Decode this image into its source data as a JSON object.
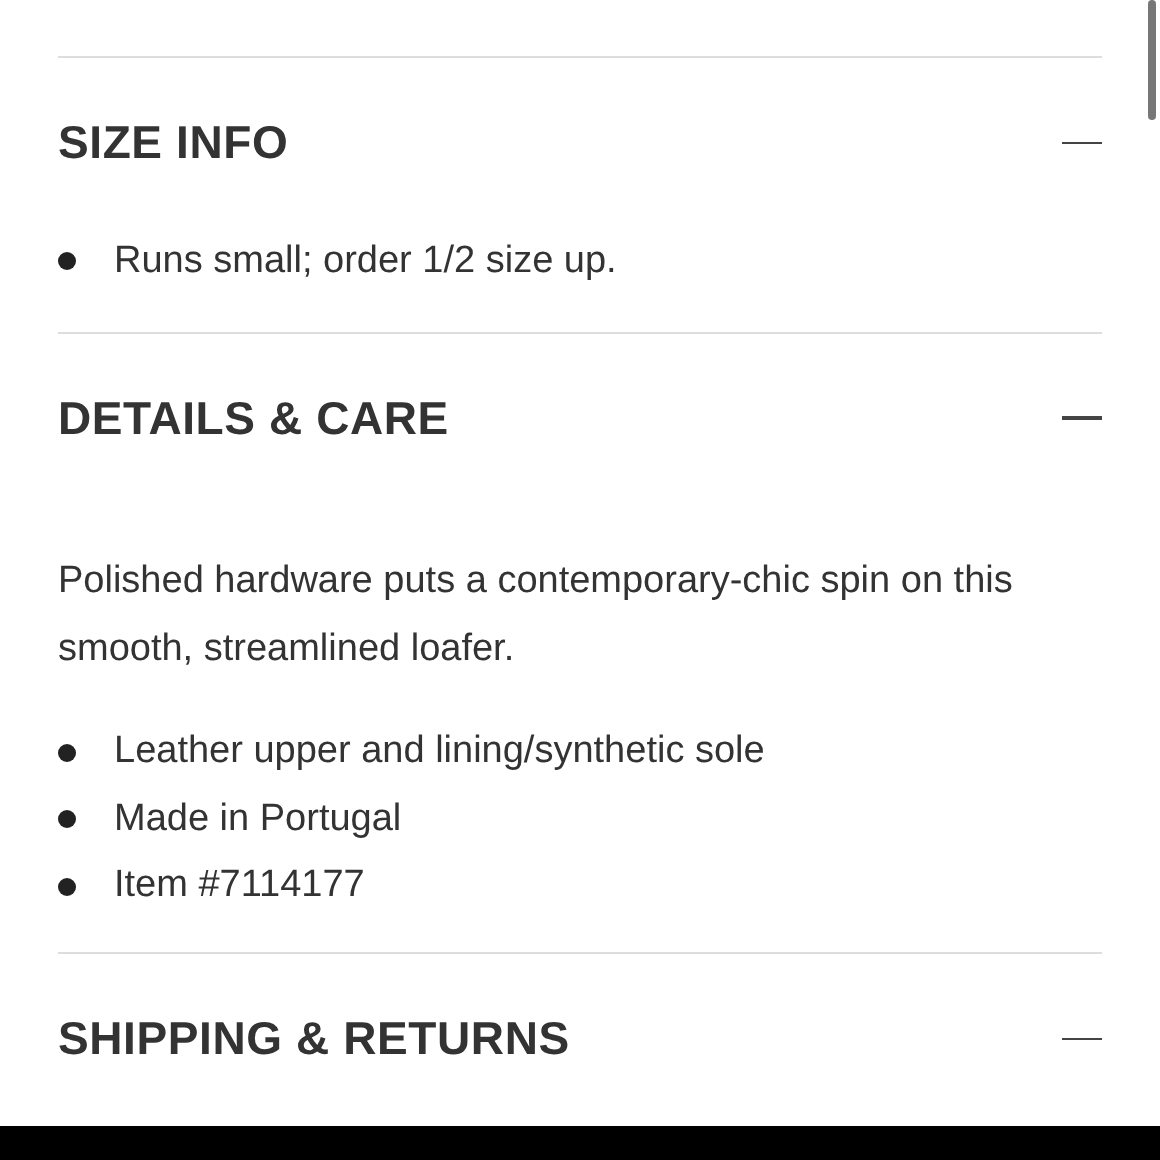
{
  "sections": [
    {
      "title": "SIZE INFO",
      "expanded": true,
      "bullets": [
        "Runs small; order 1/2 size up."
      ]
    },
    {
      "title": "DETAILS & CARE",
      "expanded": true,
      "paragraph": "Polished hardware puts a contemporary-chic spin on this smooth, streamlined loafer.",
      "bullets": [
        "Leather upper and lining/synthetic sole",
        "Made in Portugal",
        "Item #7114177"
      ]
    },
    {
      "title": "SHIPPING & RETURNS",
      "expanded": true
    }
  ]
}
